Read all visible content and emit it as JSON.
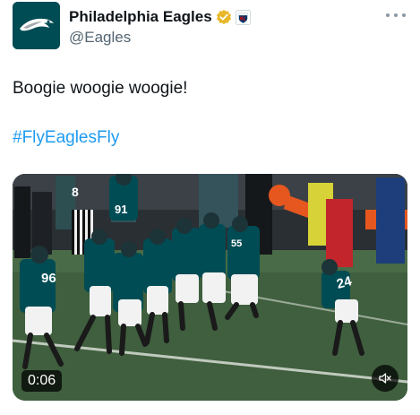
{
  "author": {
    "display_name": "Philadelphia Eagles",
    "handle": "@Eagles",
    "verified_icon": "gold-verified-badge-icon",
    "affiliate_icon": "nfl-shield-icon"
  },
  "tweet": {
    "text": "Boogie woogie woogie!",
    "hashtag": "#FlyEaglesFly"
  },
  "media": {
    "timestamp": "0:06",
    "jersey_numbers": [
      "8",
      "91",
      "96",
      "24",
      "55"
    ]
  },
  "colors": {
    "brand": "#004c54",
    "link": "#1d9bf0",
    "verified_gold": "#e8b829"
  }
}
